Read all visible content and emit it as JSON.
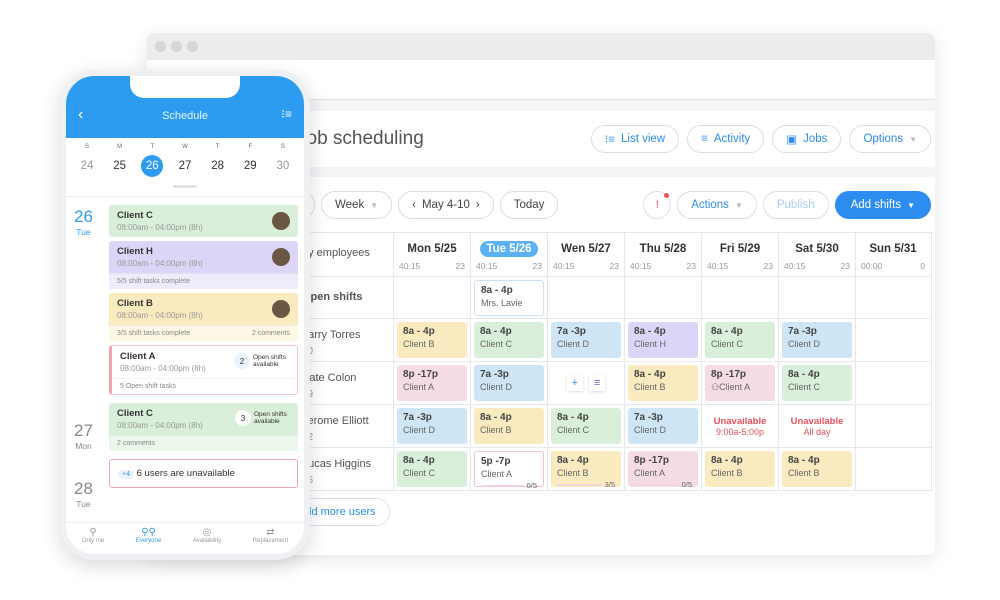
{
  "window": {
    "title": "Job scheduling",
    "header_buttons": [
      {
        "icon": "list-icon",
        "label": "List view"
      },
      {
        "icon": "activity-icon",
        "label": "Activity"
      },
      {
        "icon": "briefcase-icon",
        "label": "Jobs"
      },
      {
        "icon": "",
        "label": "Options"
      }
    ],
    "toolbar": {
      "view": "Week",
      "date_range": "May 4-10",
      "today": "Today",
      "actions": "Actions",
      "publish": "Publish",
      "add_shifts": "Add shifts"
    },
    "grid": {
      "group_label": "by employees",
      "days": [
        {
          "label": "Mon 5/25",
          "hours": "40:15",
          "count": "23"
        },
        {
          "label": "Tue 5/26",
          "hours": "40:15",
          "count": "23",
          "today": true
        },
        {
          "label": "Wen 5/27",
          "hours": "40:15",
          "count": "23"
        },
        {
          "label": "Thu 5/28",
          "hours": "40:15",
          "count": "23"
        },
        {
          "label": "Fri  5/29",
          "hours": "40:15",
          "count": "23"
        },
        {
          "label": "Sat 5/30",
          "hours": "40:15",
          "count": "23"
        },
        {
          "label": "Sun 5/31",
          "hours": "00:00",
          "count": "0"
        }
      ],
      "open_shifts_label": "Open shifts",
      "open_shift": {
        "time": "8a - 4p",
        "name": "Mrs. Lavie"
      },
      "employees": [
        {
          "name": "Larry Torres",
          "hours": "30",
          "shifts": [
            {
              "time": "8a - 4p",
              "client": "Client B",
              "color": "y"
            },
            {
              "time": "8a - 4p",
              "client": "Client C",
              "color": "gr"
            },
            {
              "time": "7a -3p",
              "client": "Client D",
              "color": "bl"
            },
            {
              "time": "8a - 4p",
              "client": "Client H",
              "color": "pu"
            },
            {
              "time": "8a - 4p",
              "client": "Client C",
              "color": "gr"
            },
            {
              "time": "7a -3p",
              "client": "Client D",
              "color": "bl"
            },
            null
          ]
        },
        {
          "name": "Kate Colon",
          "hours": "29",
          "shifts": [
            {
              "time": "8p -17p",
              "client": "Client A",
              "color": "pk"
            },
            {
              "time": "7a -3p",
              "client": "Client D",
              "color": "bl"
            },
            "add",
            {
              "time": "8a - 4p",
              "client": "Client B",
              "color": "y"
            },
            {
              "time": "8p -17p",
              "client": "Client A",
              "color": "pk",
              "group": true
            },
            {
              "time": "8a - 4p",
              "client": "Client C",
              "color": "gr"
            },
            null
          ]
        },
        {
          "name": "Jerome Elliott",
          "hours": "32",
          "shifts": [
            {
              "time": "7a -3p",
              "client": "Client D",
              "color": "bl"
            },
            {
              "time": "8a - 4p",
              "client": "Client B",
              "color": "y"
            },
            {
              "time": "8a - 4p",
              "client": "Client C",
              "color": "gr"
            },
            {
              "time": "7a -3p",
              "client": "Client D",
              "color": "bl"
            },
            {
              "unavailable": "Unavailable",
              "detail": "9:00a-5:00p"
            },
            {
              "unavailable": "Unavailable",
              "detail": "All day"
            },
            null
          ]
        },
        {
          "name": "Lucas Higgins",
          "hours": "25",
          "shifts": [
            {
              "time": "8a - 4p",
              "client": "Client C",
              "color": "gr"
            },
            {
              "time": "5p -7p",
              "client": "Client A",
              "color": "whp",
              "progress": "0/5"
            },
            {
              "time": "8a - 4p",
              "client": "Client B",
              "color": "y",
              "progress": "3/5"
            },
            {
              "time": "8p -17p",
              "client": "Client A",
              "color": "pk",
              "progress": "0/5"
            },
            {
              "time": "8a - 4p",
              "client": "Client B",
              "color": "y"
            },
            {
              "time": "8a - 4p",
              "client": "Client B",
              "color": "y"
            },
            null
          ]
        }
      ],
      "add_more": "Add more users"
    }
  },
  "phone": {
    "title": "Schedule",
    "week": [
      {
        "l": "S",
        "n": "24",
        "dim": true
      },
      {
        "l": "M",
        "n": "25"
      },
      {
        "l": "T",
        "n": "26",
        "sel": true
      },
      {
        "l": "W",
        "n": "27"
      },
      {
        "l": "T",
        "n": "28"
      },
      {
        "l": "F",
        "n": "29"
      },
      {
        "l": "S",
        "n": "30",
        "dim": true
      }
    ],
    "day26": {
      "num": "26",
      "dow": "Tue"
    },
    "day27": {
      "num": "27",
      "dow": "Mon"
    },
    "day28": {
      "num": "28",
      "dow": "Tue"
    },
    "cards": {
      "c1": {
        "client": "Client C",
        "time": "08:00am - 04:00pm (8h)"
      },
      "c2": {
        "client": "Client H",
        "time": "08:00am - 04:00pm (8h)",
        "foot": "5/5 shift tasks complete"
      },
      "c3": {
        "client": "Client B",
        "time": "08:00am - 04:00pm (8h)",
        "foot": "3/5 shift tasks complete",
        "comments": "2 comments"
      },
      "c4": {
        "client": "Client A",
        "time": "08:00am - 04:00pm (8h)",
        "open_count": "2",
        "open_label": "Open shifts available",
        "foot": "5 Open shift tasks"
      },
      "c5": {
        "client": "Client C",
        "time": "08:00am - 04:00pm (8h)",
        "open_count": "3",
        "open_label": "Open shifts available",
        "foot": "2 comments"
      },
      "c6": {
        "extra": "+4",
        "text": "6 users are unavailable"
      }
    },
    "tabs": [
      "Only me",
      "Everyone",
      "Availability",
      "Replacement"
    ]
  }
}
